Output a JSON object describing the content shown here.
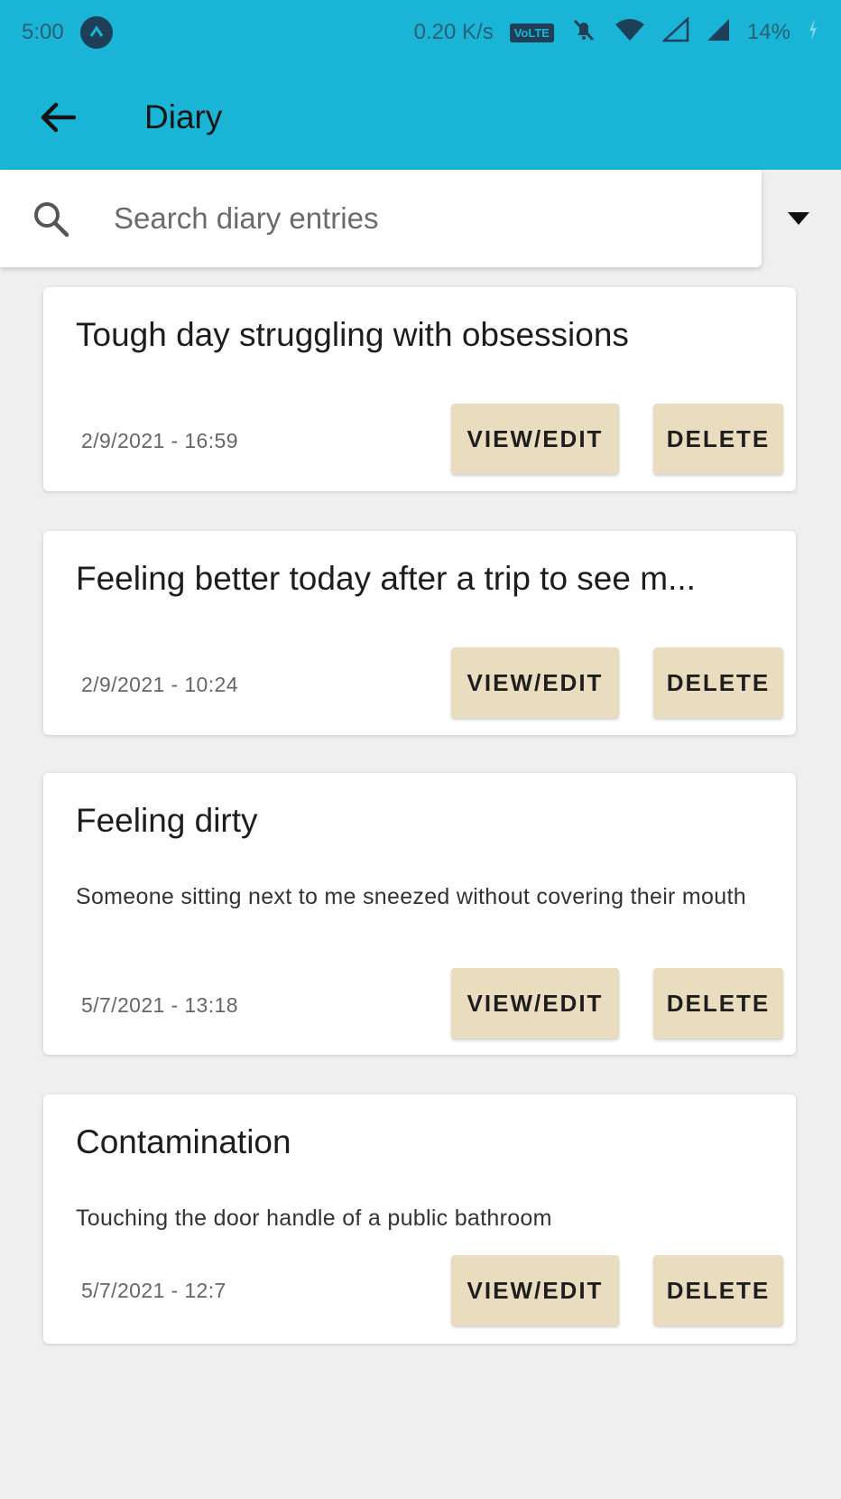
{
  "status_bar": {
    "time": "5:00",
    "net_speed": "0.20 K/s",
    "volte": "VoLTE",
    "battery": "14%"
  },
  "app_bar": {
    "title": "Diary"
  },
  "search": {
    "placeholder": "Search diary entries",
    "value": ""
  },
  "buttons": {
    "view_edit": "VIEW/EDIT",
    "delete": "DELETE"
  },
  "entries": [
    {
      "title": "Tough day struggling with obsessions",
      "description": "",
      "date": "2/9/2021 - 16:59"
    },
    {
      "title": "Feeling better today after a trip to see m...",
      "description": "",
      "date": "2/9/2021 - 10:24"
    },
    {
      "title": "Feeling dirty",
      "description": "Someone sitting next to me sneezed without covering their mouth",
      "date": "5/7/2021 - 13:18"
    },
    {
      "title": "Contamination",
      "description": "Touching the door handle of a public bathroom",
      "date": "5/7/2021 - 12:7"
    }
  ],
  "colors": {
    "app_bar": "#1ab4d6",
    "button_bg": "#e9dcbf",
    "page_bg": "#efefef"
  }
}
